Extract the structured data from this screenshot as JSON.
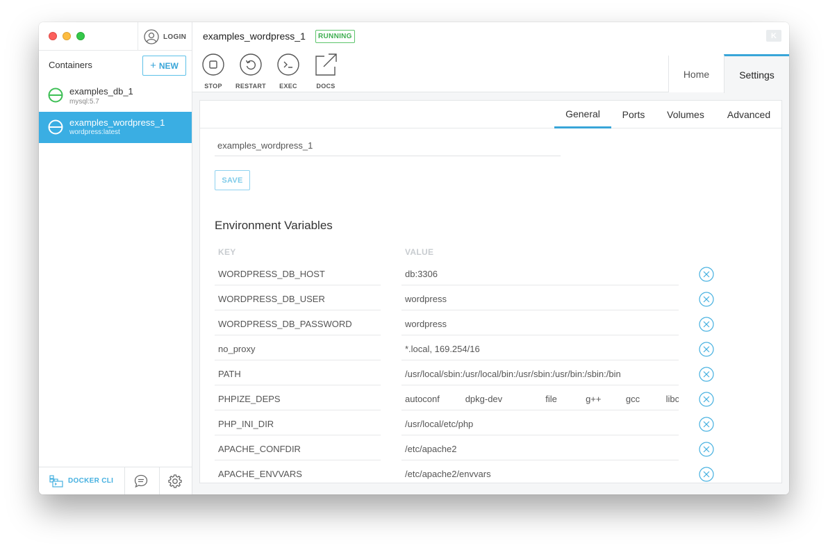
{
  "sidebar": {
    "login_label": "LOGIN",
    "containers_title": "Containers",
    "new_button_label": "NEW",
    "containers": [
      {
        "name": "examples_db_1",
        "image": "mysql:5.7",
        "selected": false
      },
      {
        "name": "examples_wordpress_1",
        "image": "wordpress:latest",
        "selected": true
      }
    ],
    "docker_cli_label": "DOCKER CLI"
  },
  "header": {
    "container_title": "examples_wordpress_1",
    "status": "RUNNING",
    "logo_text": "K",
    "actions": [
      {
        "label": "STOP",
        "icon": "stop-icon"
      },
      {
        "label": "RESTART",
        "icon": "restart-icon"
      },
      {
        "label": "EXEC",
        "icon": "terminal-icon"
      },
      {
        "label": "DOCS",
        "icon": "external-link-icon"
      }
    ],
    "tabs": {
      "home": "Home",
      "settings": "Settings"
    }
  },
  "settings": {
    "subtabs": {
      "general": "General",
      "ports": "Ports",
      "volumes": "Volumes",
      "advanced": "Advanced"
    },
    "container_name_value": "examples_wordpress_1",
    "save_label": "SAVE",
    "env_title": "Environment Variables",
    "key_header": "KEY",
    "value_header": "VALUE",
    "env": [
      {
        "key": "WORDPRESS_DB_HOST",
        "value": "db:3306"
      },
      {
        "key": "WORDPRESS_DB_USER",
        "value": "wordpress"
      },
      {
        "key": "WORDPRESS_DB_PASSWORD",
        "value": "wordpress"
      },
      {
        "key": "no_proxy",
        "value": "*.local, 169.254/16"
      },
      {
        "key": "PATH",
        "value": "/usr/local/sbin:/usr/local/bin:/usr/sbin:/usr/bin:/sbin:/bin"
      },
      {
        "key": "PHPIZE_DEPS",
        "value": "autoconf \t\tdpkg-dev \t\tfile \t\tg++ \t\tgcc \t\tlibc"
      },
      {
        "key": "PHP_INI_DIR",
        "value": "/usr/local/etc/php"
      },
      {
        "key": "APACHE_CONFDIR",
        "value": "/etc/apache2"
      },
      {
        "key": "APACHE_ENVVARS",
        "value": "/etc/apache2/envvars"
      }
    ]
  },
  "colors": {
    "accent": "#38a5d8",
    "running": "#3dae4f",
    "selected_bg": "#3aaee3"
  }
}
